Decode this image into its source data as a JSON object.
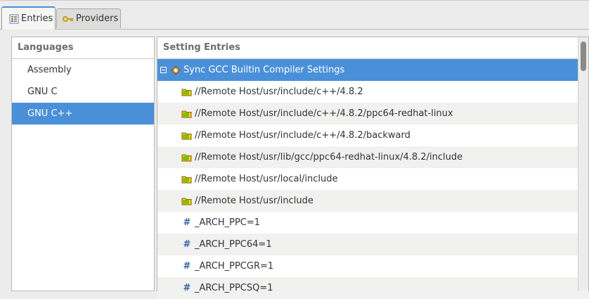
{
  "tabs": [
    {
      "label": "Entries",
      "icon": "entries-icon",
      "active": true
    },
    {
      "label": "Providers",
      "icon": "key-icon",
      "active": false
    }
  ],
  "languages": {
    "header": "Languages",
    "items": [
      "Assembly",
      "GNU C",
      "GNU C++"
    ],
    "selected": "GNU C++"
  },
  "entries": {
    "header": "Setting Entries",
    "root": {
      "label": "Sync GCC Builtin Compiler Settings",
      "icon": "gear-icon",
      "expanded": true
    },
    "items": [
      {
        "type": "include",
        "icon": "folder-include-icon",
        "label": "//Remote Host/usr/include/c++/4.8.2"
      },
      {
        "type": "include",
        "icon": "folder-include-icon",
        "label": "//Remote Host/usr/include/c++/4.8.2/ppc64-redhat-linux"
      },
      {
        "type": "include",
        "icon": "folder-include-icon",
        "label": "//Remote Host/usr/include/c++/4.8.2/backward"
      },
      {
        "type": "include",
        "icon": "folder-include-icon",
        "label": "//Remote Host/usr/lib/gcc/ppc64-redhat-linux/4.8.2/include"
      },
      {
        "type": "include",
        "icon": "folder-include-icon",
        "label": "//Remote Host/usr/local/include"
      },
      {
        "type": "include",
        "icon": "folder-include-icon",
        "label": "//Remote Host/usr/include"
      },
      {
        "type": "macro",
        "icon": "hash-icon",
        "label": "_ARCH_PPC=1"
      },
      {
        "type": "macro",
        "icon": "hash-icon",
        "label": "_ARCH_PPC64=1"
      },
      {
        "type": "macro",
        "icon": "hash-icon",
        "label": "_ARCH_PPCGR=1"
      },
      {
        "type": "macro",
        "icon": "hash-icon",
        "label": "_ARCH_PPCSQ=1"
      }
    ]
  },
  "colors": {
    "selection": "#4a90d9",
    "macro": "#3465a4"
  }
}
